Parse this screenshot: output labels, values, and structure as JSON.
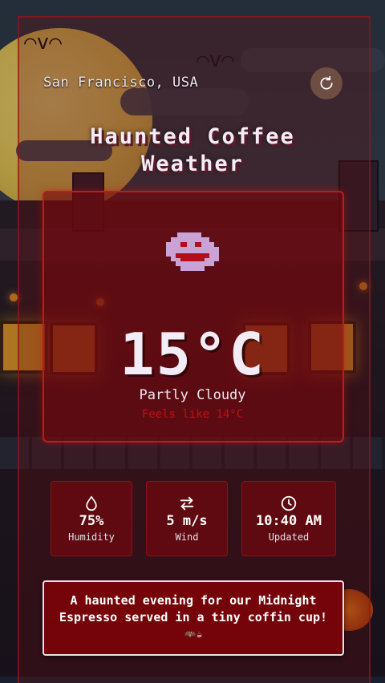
{
  "header": {
    "location": "San Francisco, USA",
    "title_line1": "Haunted Coffee",
    "title_line2": "Weather"
  },
  "weather": {
    "temperature": "15°C",
    "condition": "Partly Cloudy",
    "feels_like": "Feels like 14°C",
    "icon": "ghost-icon"
  },
  "stats": [
    {
      "value": "75%",
      "label": "Humidity",
      "icon": "droplet-icon"
    },
    {
      "value": "5 m/s",
      "label": "Wind",
      "icon": "arrows-exchange-icon"
    },
    {
      "value": "10:40 AM",
      "label": "Updated",
      "icon": "clock-icon"
    }
  ],
  "message": {
    "text": "A haunted evening for our Midnight Espresso served in a tiny coffin cup!",
    "emoji": "🦇☕"
  },
  "colors": {
    "accent": "#c01a1a",
    "card": "#740409",
    "moon": "#e6c653"
  }
}
